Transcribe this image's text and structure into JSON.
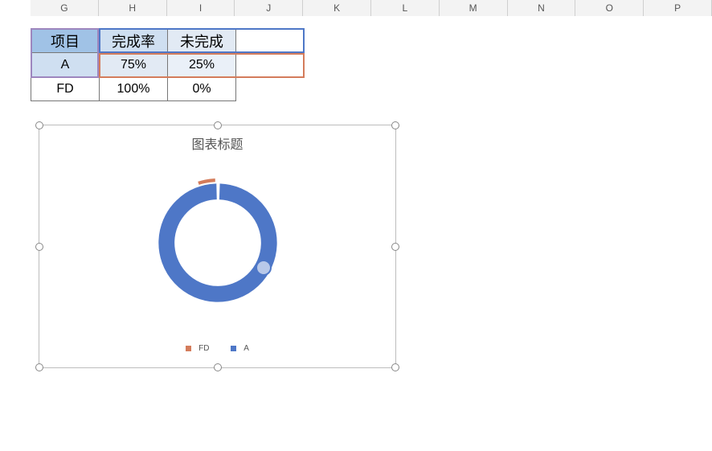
{
  "columns": [
    "G",
    "H",
    "I",
    "J",
    "K",
    "L",
    "M",
    "N",
    "O",
    "P"
  ],
  "table": {
    "headers": [
      "项目",
      "完成率",
      "未完成"
    ],
    "rows": [
      {
        "c1": "A",
        "c2": "75%",
        "c3": "25%"
      },
      {
        "c1": "FD",
        "c2": "100%",
        "c3": "0%"
      }
    ]
  },
  "chart": {
    "title": "图表标题",
    "legend": {
      "fd": "FD",
      "a": "A"
    },
    "colors": {
      "fd": "#d47c5b",
      "a": "#4e77c7"
    }
  },
  "chart_data": {
    "type": "pie",
    "title": "图表标题",
    "series": [
      {
        "name": "FD",
        "categories": [
          "完成率",
          "未完成"
        ],
        "values": [
          100,
          0
        ]
      },
      {
        "name": "A",
        "categories": [
          "完成率",
          "未完成"
        ],
        "values": [
          75,
          25
        ]
      }
    ],
    "legend_position": "bottom"
  }
}
